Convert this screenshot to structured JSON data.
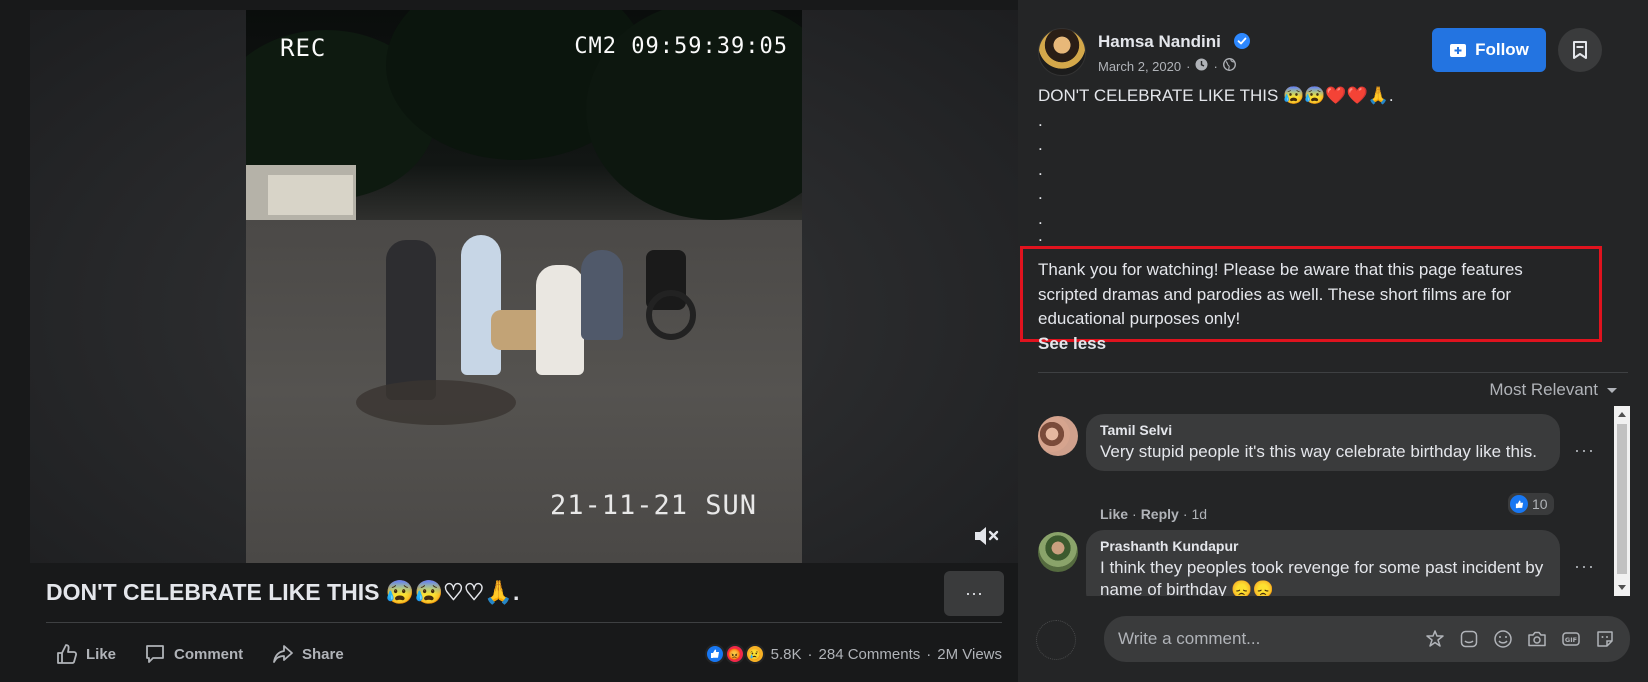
{
  "video": {
    "overlay_rec": "REC",
    "overlay_camera": "CM2 09:59:39:05",
    "overlay_date": "21-11-21 SUN",
    "mute_icon": "speaker-muted-icon"
  },
  "post": {
    "title": "DON'T CELEBRATE LIKE THIS 😰😰♡♡🙏.",
    "more_label": "···",
    "actions": {
      "like": "Like",
      "comment": "Comment",
      "share": "Share"
    },
    "stats": {
      "reactions": "5.8K",
      "comments": "284 Comments",
      "views": "2M Views",
      "separator": "·"
    }
  },
  "author": {
    "name": "Hamsa Nandini",
    "date": "March 2, 2020",
    "follow_label": "Follow",
    "meta_separator": "·"
  },
  "caption": {
    "lines": [
      "DON'T CELEBRATE LIKE THIS 😰😰❤️❤️🙏.",
      ".",
      ".",
      ".",
      ".",
      ".",
      "."
    ],
    "disclaimer": "Thank you for watching! Please be aware that this page features scripted dramas and parodies as well. These short films are for educational purposes only!",
    "see_less": "See less"
  },
  "comments_section": {
    "sort_label": "Most Relevant",
    "comments": [
      {
        "author": "Tamil Selvi",
        "text": "Very stupid people it's this way celebrate birthday like this.",
        "like": "Like",
        "reply": "Reply",
        "time": "1d",
        "reaction_count": "10",
        "more": "···"
      },
      {
        "author": "Prashanth Kundapur",
        "text": "I think they peoples took revenge for some past incident by name of birthday 😞😞",
        "more": "···"
      }
    ],
    "composer_placeholder": "Write a comment..."
  },
  "colors": {
    "accent": "#2374e1",
    "highlight_border": "#e0131e",
    "panel_bg": "#242526",
    "page_bg": "#18191a"
  }
}
